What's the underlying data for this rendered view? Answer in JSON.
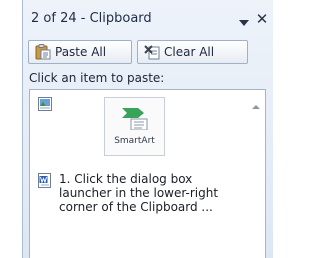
{
  "pane": {
    "title": "2 of 24 - Clipboard",
    "dropdown_icon": "chevron-down-icon",
    "close_icon": "close-icon"
  },
  "toolbar": {
    "paste_all_label": "Paste All",
    "paste_all_icon": "paste-icon",
    "clear_all_label": "Clear All",
    "clear_all_icon": "clear-icon"
  },
  "instruction": "Click an item to paste:",
  "items": [
    {
      "type_icon": "picture-icon",
      "thumbnail_caption": "SmartArt"
    },
    {
      "type_icon": "word-document-icon",
      "text": "1. Click the dialog box launcher in the lower-right corner of the Clipboard ..."
    }
  ],
  "colors": {
    "pane_background": "#dde7f4",
    "smartart_green": "#3aa35a"
  }
}
